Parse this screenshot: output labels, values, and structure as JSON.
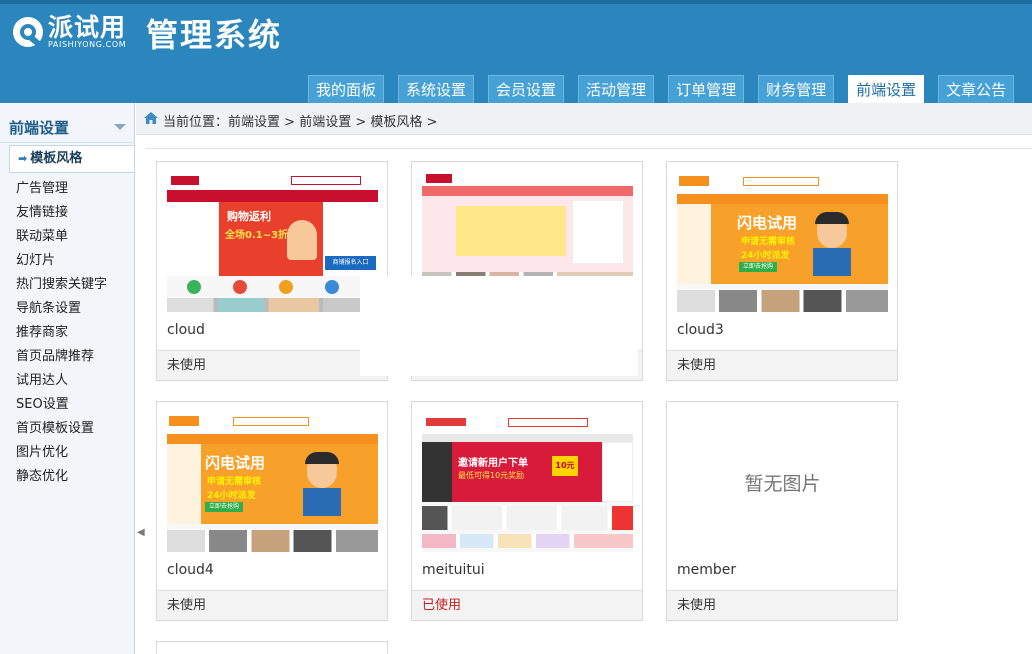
{
  "header": {
    "logo_cn": "派试用",
    "logo_en": "PAISHIYONG.COM",
    "system_title": "管理系统",
    "tabs": [
      {
        "label": "我的面板",
        "active": false
      },
      {
        "label": "系统设置",
        "active": false
      },
      {
        "label": "会员设置",
        "active": false
      },
      {
        "label": "活动管理",
        "active": false
      },
      {
        "label": "订单管理",
        "active": false
      },
      {
        "label": "财务管理",
        "active": false
      },
      {
        "label": "前端设置",
        "active": true
      },
      {
        "label": "文章公告",
        "active": false
      }
    ]
  },
  "sidebar": {
    "title": "前端设置",
    "active_item": "模板风格",
    "items": [
      "广告管理",
      "友情链接",
      "联动菜单",
      "幻灯片",
      "热门搜索关键字",
      "导航条设置",
      "推荐商家",
      "首页品牌推荐",
      "试用达人",
      "SEO设置",
      "首页模板设置",
      "图片优化",
      "静态优化"
    ]
  },
  "breadcrumb": [
    "当前位置：前端设置",
    "前端设置",
    "模板风格"
  ],
  "templates": [
    {
      "name": "cloud",
      "status": "未使用",
      "used": false,
      "thumb": "cloud"
    },
    {
      "name": "",
      "status": "",
      "used": false,
      "thumb": "cloud2"
    },
    {
      "name": "cloud3",
      "status": "未使用",
      "used": false,
      "thumb": "flash"
    },
    {
      "name": "cloud4",
      "status": "未使用",
      "used": false,
      "thumb": "flash"
    },
    {
      "name": "meituitui",
      "status": "已使用",
      "used": true,
      "thumb": "meituitui"
    },
    {
      "name": "member",
      "status": "未使用",
      "used": false,
      "thumb": "none",
      "placeholder": "暂无图片"
    }
  ],
  "thumb_text": {
    "flash_headline": "闪电试用",
    "flash_sub": "申请无需审核",
    "flash_sub2": "24小时派发",
    "flash_btn": "立即去抢购",
    "cloud_headline": "购物返利",
    "cloud_sub": "全场0.1~3折",
    "cloud_side": "商铺报名入口",
    "mt_headline": "邀请新用户下单",
    "mt_sub": "最低可得10元奖励",
    "mt_coupon": "10元"
  },
  "colors": {
    "header_bg": "#2b86bd",
    "used_status": "#c41e1e",
    "flash_orange": "#f5901e",
    "cloud_red": "#c8102e"
  }
}
